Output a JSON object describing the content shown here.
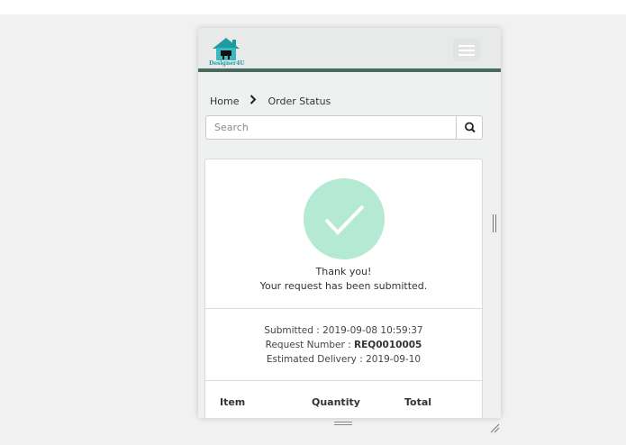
{
  "header": {
    "logo_text": "Designer4U",
    "menu_icon": "hamburger-menu-icon"
  },
  "breadcrumb": {
    "home": "Home",
    "separator_icon": "chevron-right-icon",
    "current": "Order Status"
  },
  "search": {
    "placeholder": "Search",
    "value": "",
    "button_icon": "search-icon"
  },
  "confirmation": {
    "icon": "checkmark-icon",
    "thank_you": "Thank you!",
    "message": "Your request has been submitted.",
    "submitted_label": "Submitted : ",
    "submitted_value": "2019-09-08 10:59:37",
    "request_label": "Request Number : ",
    "request_value": "REQ0010005",
    "delivery_label": "Estimated Delivery : ",
    "delivery_value": "2019-09-10"
  },
  "table": {
    "columns": [
      "Item",
      "Quantity",
      "Total"
    ]
  },
  "colors": {
    "accent_bar": "#496a5e",
    "success_circle": "#b4e9d3",
    "logo_teal": "#1f9aa0"
  }
}
